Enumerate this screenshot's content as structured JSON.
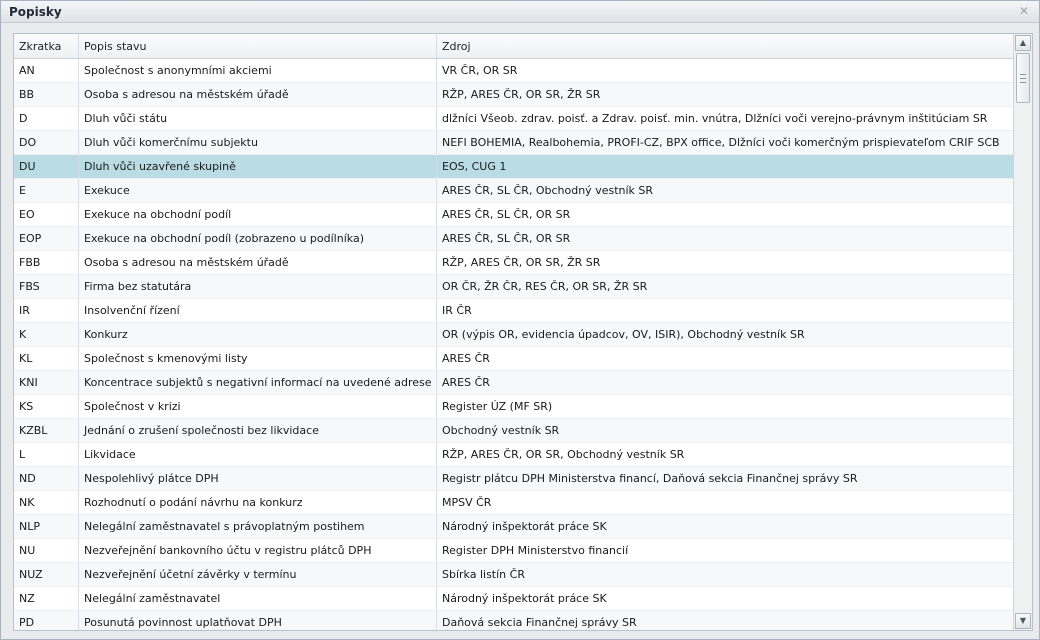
{
  "window": {
    "title": "Popisky",
    "close_icon": "close-icon"
  },
  "table": {
    "columns": [
      "Zkratka",
      "Popis stavu",
      "Zdroj"
    ],
    "selected_row": 4,
    "rows": [
      [
        "AN",
        "Společnost s anonymními akciemi",
        "VR ČR, OR SR"
      ],
      [
        "BB",
        "Osoba s adresou na městském úřadě",
        "RŽP, ARES ČR, OR SR, ŽR SR"
      ],
      [
        "D",
        "Dluh vůči státu",
        "dlžníci Všeob. zdrav. poisť. a Zdrav. poisť. min. vnútra, Dlžníci voči verejno-právnym inštitúciam SR"
      ],
      [
        "DO",
        "Dluh vůči komerčnímu subjektu",
        "NEFI BOHEMIA, Realbohemia, PROFI-CZ, BPX office, Dlžníci voči komerčným prispievateľom CRIF SCB"
      ],
      [
        "DU",
        "Dluh vůči uzavřené skupině",
        "EOS, CUG 1"
      ],
      [
        "E",
        "Exekuce",
        "ARES ČR, SL ČR, Obchodný vestník SR"
      ],
      [
        "EO",
        "Exekuce na obchodní podíl",
        "ARES ČR, SL ČR, OR SR"
      ],
      [
        "EOP",
        "Exekuce na obchodní podíl (zobrazeno u podílníka)",
        "ARES ČR, SL ČR, OR SR"
      ],
      [
        "FBB",
        "Osoba s adresou na městském úřadě",
        "RŽP, ARES ČR, OR SR, ŽR SR"
      ],
      [
        "FBS",
        "Firma bez statutára",
        "OR ČR, ŽR ČR, RES ČR, OR SR, ŽR SR"
      ],
      [
        "IR",
        "Insolvenční řízení",
        "IR ČR"
      ],
      [
        "K",
        "Konkurz",
        "OR (výpis OR, evidencia úpadcov, OV, ISIR), Obchodný vestník SR"
      ],
      [
        "KL",
        "Společnost s kmenovými listy",
        "ARES ČR"
      ],
      [
        "KNI",
        "Koncentrace subjektů s negativní informací na uvedené adrese",
        "ARES ČR"
      ],
      [
        "KS",
        "Společnost v krizi",
        "Register ÚZ (MF SR)"
      ],
      [
        "KZBL",
        "Jednání o zrušení společnosti bez likvidace",
        "Obchodný vestník SR"
      ],
      [
        "L",
        "Likvidace",
        "RŽP, ARES ČR, OR SR, Obchodný vestník SR"
      ],
      [
        "ND",
        "Nespolehlivý plátce DPH",
        "Registr plátcu DPH Ministerstva financí, Daňová sekcia Finančnej správy SR"
      ],
      [
        "NK",
        "Rozhodnutí o podání návrhu na konkurz",
        "MPSV ČR"
      ],
      [
        "NLP",
        "Nelegální zaměstnavatel s právoplatným postihem",
        "Národný inšpektorát práce SK"
      ],
      [
        "NU",
        "Nezveřejnění bankovního účtu v registru plátců DPH",
        "Register DPH Ministerstvo financií"
      ],
      [
        "NUZ",
        "Nezveřejnění účetní závěrky v termínu",
        "Sbírka listín ČR"
      ],
      [
        "NZ",
        "Nelegální zaměstnavatel",
        "Národný inšpektorát práce SK"
      ],
      [
        "PD",
        "Posunutá povinnost uplatňovat DPH",
        "Daňová sekcia Finančnej správy SR"
      ]
    ]
  },
  "scrollbar": {
    "up_icon": "scroll-up-arrow-icon",
    "down_icon": "scroll-down-arrow-icon",
    "up_glyph": "▲",
    "down_glyph": "▼"
  }
}
